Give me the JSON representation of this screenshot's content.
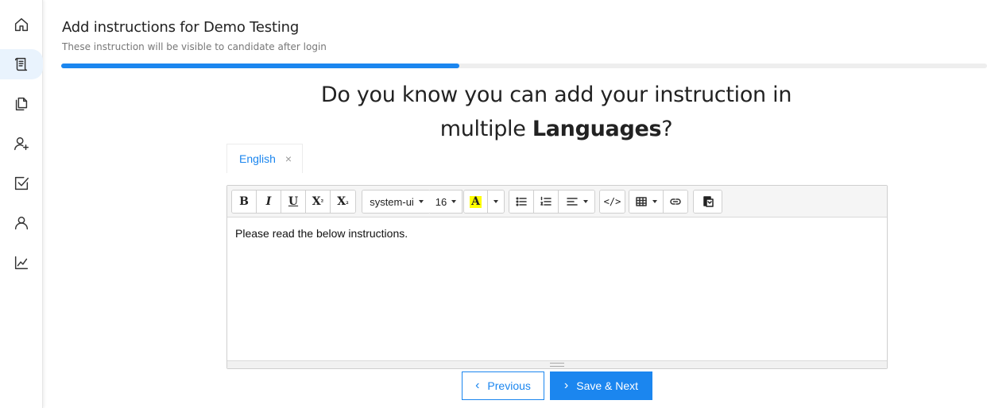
{
  "sidebar": {
    "items": [
      {
        "name": "home",
        "icon": "home-icon"
      },
      {
        "name": "instructions",
        "icon": "scroll-icon",
        "active": true
      },
      {
        "name": "documents",
        "icon": "documents-icon"
      },
      {
        "name": "add-user",
        "icon": "user-plus-icon"
      },
      {
        "name": "tasks",
        "icon": "checkbox-icon"
      },
      {
        "name": "profile",
        "icon": "user-icon"
      },
      {
        "name": "analytics",
        "icon": "line-chart-icon"
      }
    ]
  },
  "header": {
    "title": "Add instructions for Demo Testing",
    "subtitle": "These instruction will be visible to candidate after login",
    "progress": 0.43
  },
  "promo": {
    "line1": "Do you know you can add your instruction in",
    "line2_prefix": "multiple ",
    "line2_bold": "Languages",
    "line2_suffix": "?"
  },
  "tabs": [
    {
      "label": "English",
      "close": "×"
    }
  ],
  "toolbar": {
    "bold": "B",
    "italic": "I",
    "underline": "U",
    "superscript": "X",
    "superscript_mark": "²",
    "subscript": "X",
    "subscript_mark": "₂",
    "font_family": "system-ui",
    "font_size": "16",
    "highlight": "A",
    "code": "</>"
  },
  "editor": {
    "content": "Please read the below instructions."
  },
  "buttons": {
    "previous": "Previous",
    "previous_icon": "chevron-left-icon",
    "save_next": "Save & Next",
    "save_next_icon": "chevron-right-icon"
  },
  "colors": {
    "accent": "#1b86ef",
    "highlight": "#ffff00"
  }
}
